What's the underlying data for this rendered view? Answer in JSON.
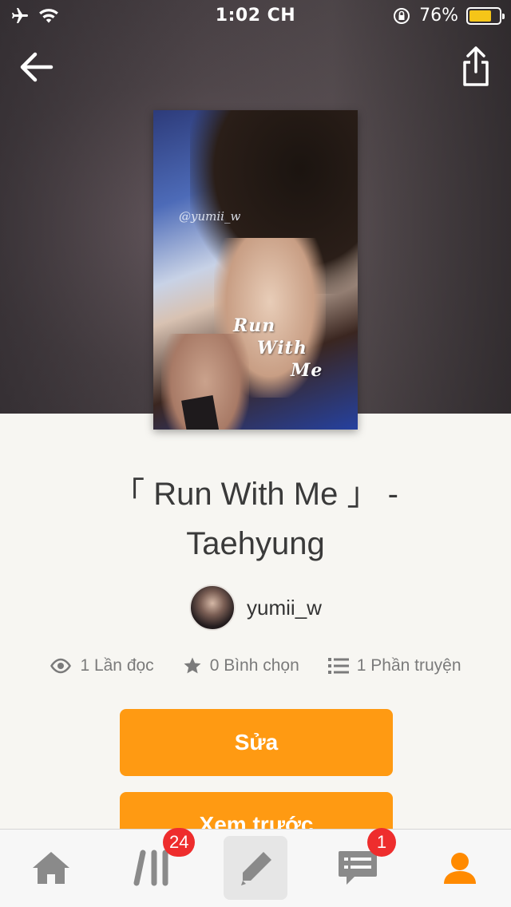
{
  "status_bar": {
    "time": "1:02 CH",
    "battery_percent": "76%",
    "battery_level": 0.76,
    "battery_color": "#f5c518"
  },
  "header": {
    "back_icon": "arrow-left-icon",
    "share_icon": "share-icon"
  },
  "cover": {
    "watermark": "@yumii_w",
    "title_lines": [
      "Run",
      "With",
      "Me"
    ]
  },
  "story": {
    "title_line1": "「 Run With Me 」 -",
    "title_line2": "Taehyung",
    "author": "yumii_w"
  },
  "stats": {
    "reads": "1 Lần đọc",
    "votes": "0 Bình chọn",
    "parts": "1 Phần truyện"
  },
  "actions": {
    "edit_label": "Sửa",
    "preview_label": "Xem trước",
    "accent_color": "#ff9a12"
  },
  "tab_bar": {
    "library_badge": "24",
    "messages_badge": "1",
    "active_color": "#ff8a00"
  }
}
